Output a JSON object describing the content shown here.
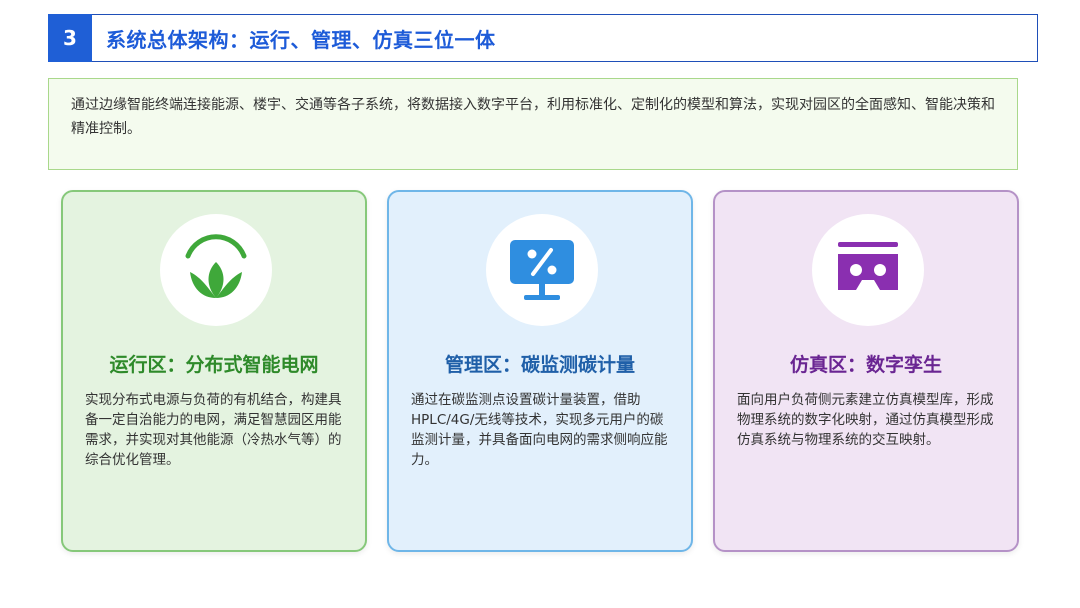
{
  "header": {
    "number": "3",
    "title": "系统总体架构：运行、管理、仿真三位一体"
  },
  "intro": {
    "text": "通过边缘智能终端连接能源、楼宇、交通等各子系统，将数据接入数字平台，利用标准化、定制化的模型和算法，实现对园区的全面感知、智能决策和精准控制。"
  },
  "cards": [
    {
      "icon": "lotus-icon",
      "title": "运行区：分布式智能电网",
      "desc": "实现分布式电源与负荷的有机结合，构建具备一定自治能力的电网，满足智慧园区用能需求，并实现对其他能源（冷热水气等）的综合优化管理。",
      "accent": "#2e8a2a"
    },
    {
      "icon": "percent-monitor-icon",
      "title": "管理区：碳监测碳计量",
      "desc": "通过在碳监测点设置碳计量装置，借助HPLC/4G/无线等技术，实现多元用户的碳监测计量，并具备面向电网的需求侧响应能力。",
      "accent": "#1f5fa8"
    },
    {
      "icon": "vr-headset-icon",
      "title": "仿真区：数字孪生",
      "desc": "面向用户负荷侧元素建立仿真模型库，形成物理系统的数字化映射，通过仿真模型形成仿真系统与物理系统的交互映射。",
      "accent": "#6a2592"
    }
  ]
}
